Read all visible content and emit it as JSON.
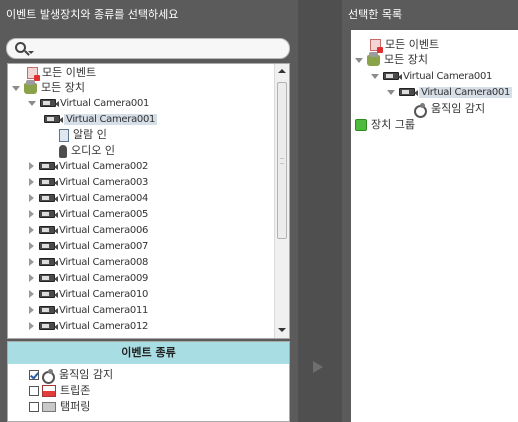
{
  "left_panel": {
    "title": "이벤트 발생장치와 종류를 선택하세요",
    "search": {
      "value": "",
      "placeholder": ""
    },
    "tree": {
      "all_events": "모든 이벤트",
      "all_devices": "모든 장치",
      "camera_parent": "Virtual Camera001",
      "camera_child": "Virtual Camera001",
      "alarm_in": "알람 인",
      "audio_in": "오디오 인",
      "cameras": [
        "Virtual Camera002",
        "Virtual Camera003",
        "Virtual Camera004",
        "Virtual Camera005",
        "Virtual Camera006",
        "Virtual Camera007",
        "Virtual Camera008",
        "Virtual Camera009",
        "Virtual Camera010",
        "Virtual Camera011",
        "Virtual Camera012"
      ]
    },
    "event_types": {
      "header": "이벤트 종류",
      "items": [
        {
          "label": "움직임 감지",
          "checked": true
        },
        {
          "label": "트립존",
          "checked": false
        },
        {
          "label": "탬퍼링",
          "checked": false
        }
      ]
    }
  },
  "right_panel": {
    "title": "선택한 목록",
    "tree": {
      "all_events": "모든 이벤트",
      "all_devices": "모든 장치",
      "camera_parent": "Virtual Camera001",
      "camera_child": "Virtual Camera001",
      "motion": "움직임 감지",
      "device_group": "장치 그룹"
    }
  }
}
